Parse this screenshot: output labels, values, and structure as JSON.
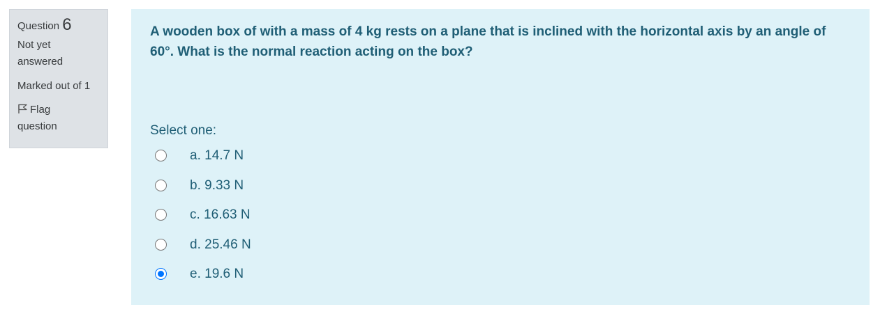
{
  "info": {
    "question_label": "Question",
    "question_number": "6",
    "state": "Not yet answered",
    "grade": "Marked out of 1",
    "flag_label": "Flag question",
    "flag_icon": "flag-outline-icon"
  },
  "question": {
    "text": "A wooden box of with a mass of 4 kg rests on a plane that is inclined with the horizontal axis by an angle of 60°. What is the normal reaction acting on the box?",
    "prompt": "Select one:",
    "answers": [
      {
        "label": "a. 14.7 N",
        "checked": false
      },
      {
        "label": "b. 9.33 N",
        "checked": false
      },
      {
        "label": "c. 16.63 N",
        "checked": false
      },
      {
        "label": "d. 25.46 N",
        "checked": false
      },
      {
        "label": "e. 19.6 N",
        "checked": true
      }
    ]
  },
  "colors": {
    "info_background": "#dee2e6",
    "content_background": "#def2f8",
    "question_text": "#1f5e75",
    "radio_selected": "#0075ff"
  }
}
